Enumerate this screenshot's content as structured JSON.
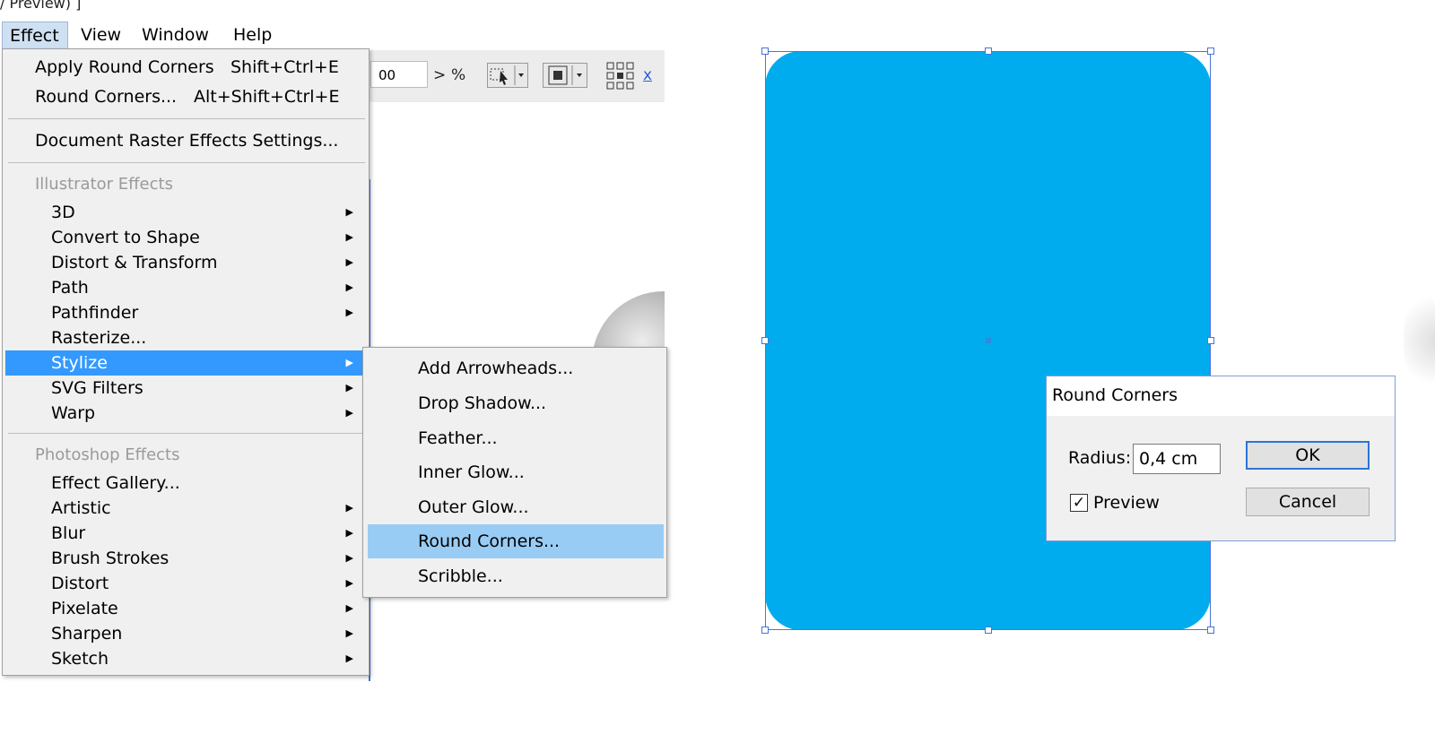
{
  "window": {
    "title_fragment": "/ Preview) ]"
  },
  "menubar": {
    "items": [
      {
        "label": "Effect",
        "active": true
      },
      {
        "label": "View"
      },
      {
        "label": "Window"
      },
      {
        "label": "Help"
      }
    ]
  },
  "toolbar": {
    "zoom_value": "00",
    "percent": "%",
    "arrow": ">"
  },
  "effect_menu": {
    "apply_round_corners": {
      "label": "Apply Round Corners",
      "shortcut": "Shift+Ctrl+E"
    },
    "round_corners": {
      "label": "Round Corners...",
      "shortcut": "Alt+Shift+Ctrl+E"
    },
    "document_raster": {
      "label": "Document Raster Effects Settings..."
    },
    "illustrator_header": "Illustrator Effects",
    "illustrator_items": [
      "3D",
      "Convert to Shape",
      "Distort & Transform",
      "Path",
      "Pathfinder",
      "Rasterize...",
      "Stylize",
      "SVG Filters",
      "Warp"
    ],
    "photoshop_header": "Photoshop Effects",
    "photoshop_items": [
      "Effect Gallery...",
      "Artistic",
      "Blur",
      "Brush Strokes",
      "Distort",
      "Pixelate",
      "Sharpen",
      "Sketch"
    ],
    "selected": "Stylize"
  },
  "stylize_submenu": {
    "items": [
      "Add Arrowheads...",
      "Drop Shadow...",
      "Feather...",
      "Inner Glow...",
      "Outer Glow...",
      "Round Corners...",
      "Scribble..."
    ],
    "selected": "Round Corners..."
  },
  "dialog": {
    "title": "Round Corners",
    "radius_label": "Radius:",
    "radius_value": "0,4 cm",
    "preview_label": "Preview",
    "preview_checked": true,
    "ok_label": "OK",
    "cancel_label": "Cancel"
  },
  "colors": {
    "shape_fill": "#00acee",
    "selection": "#3399ff",
    "submenu_hover": "#99ccf5",
    "bbox": "#4a74d6"
  }
}
